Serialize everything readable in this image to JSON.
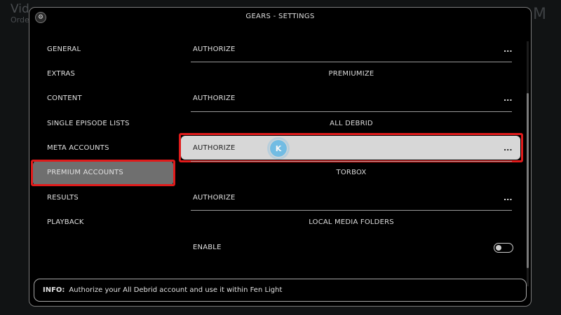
{
  "background": {
    "title": "Vid",
    "subtitle": "Orde",
    "right_text": "M"
  },
  "dialog": {
    "title": "GEARS - SETTINGS",
    "icon": "gear-icon"
  },
  "nav": {
    "items": [
      {
        "label": "GENERAL"
      },
      {
        "label": "EXTRAS"
      },
      {
        "label": "CONTENT"
      },
      {
        "label": "SINGLE EPISODE LISTS"
      },
      {
        "label": "META ACCOUNTS"
      },
      {
        "label": "PREMIUM ACCOUNTS"
      },
      {
        "label": "RESULTS"
      },
      {
        "label": "PLAYBACK"
      }
    ],
    "active_index": 5
  },
  "settings": {
    "rows": [
      {
        "label": "AUTHORIZE",
        "value": "..."
      },
      {
        "label": "AUTHORIZE",
        "value": "..."
      },
      {
        "label": "AUTHORIZE",
        "value": "..."
      },
      {
        "label": "AUTHORIZE",
        "value": "..."
      },
      {
        "label": "ENABLE",
        "toggle": false
      }
    ],
    "sections": [
      "PREMIUMIZE",
      "ALL DEBRID",
      "TORBOX",
      "LOCAL MEDIA FOLDERS"
    ],
    "focused_index": 2
  },
  "info": {
    "label": "INFO:",
    "text": "Authorize your All Debrid account and use it within Fen Light"
  },
  "colors": {
    "highlight": "#e01b1b",
    "focus_bg": "#d7d7d7",
    "active_nav_bg": "#6f6f6f"
  }
}
